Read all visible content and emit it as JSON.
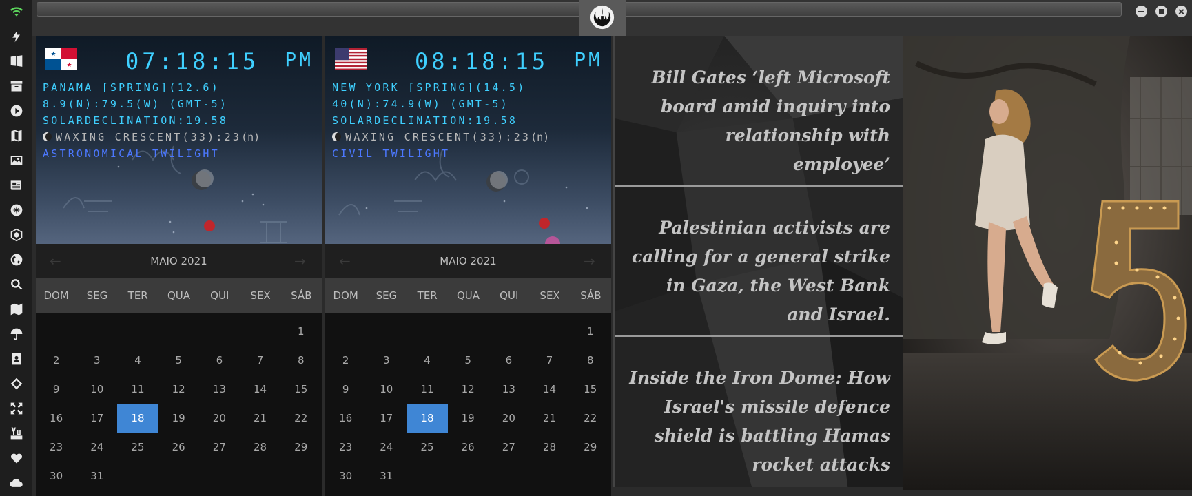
{
  "window": {
    "title_field": ""
  },
  "sidebar": {
    "items": [
      "wifi-icon",
      "lightning-icon",
      "windows-icon",
      "archive-icon",
      "play-icon",
      "map-book-icon",
      "image-icon",
      "news-icon",
      "rebel-icon",
      "hexagon-icon",
      "globe-icon",
      "search-icon",
      "map-icon",
      "umbrella-icon",
      "contact-icon",
      "link-icon",
      "expand-icon",
      "youtube-icon",
      "heart-icon",
      "cloud-icon"
    ]
  },
  "clocks": [
    {
      "flag": "panama",
      "time": "07:18:15",
      "ampm": "PM",
      "location": "PANAMA [SPRING](12.6)",
      "coords": "8.9(N):79.5(W) (GMT-5)",
      "solar": "SOLARDECLINATION:19.58",
      "moon": "WAXING CRESCENT(33):23",
      "moon_suffix": "(n)",
      "twilight": "ASTRONOMICAL TWILIGHT"
    },
    {
      "flag": "usa",
      "time": "08:18:15",
      "ampm": "PM",
      "location": "NEW YORK [SPRING](14.5)",
      "coords": "40(N):74.9(W) (GMT-5)",
      "solar": "SOLARDECLINATION:19.58",
      "moon": "WAXING CRESCENT(33):23",
      "moon_suffix": "(n)",
      "twilight": "CIVIL TWILIGHT"
    }
  ],
  "calendars": [
    {
      "month": "MAIO 2021",
      "prev": "←",
      "next": "→",
      "weekdays": [
        "DOM",
        "SEG",
        "TER",
        "QUA",
        "QUI",
        "SEX",
        "SÁB"
      ],
      "first_weekday": 6,
      "days_in_month": 31,
      "selected": 18
    },
    {
      "month": "MAIO 2021",
      "prev": "←",
      "next": "→",
      "weekdays": [
        "DOM",
        "SEG",
        "TER",
        "QUA",
        "QUI",
        "SEX",
        "SÁB"
      ],
      "first_weekday": 6,
      "days_in_month": 31,
      "selected": 18
    }
  ],
  "news": {
    "stories": [
      "Bill Gates ‘left Microsoft board amid inquiry into relationship with employee’",
      "Palestinian activists are calling for a general strike in Gaza, the West Bank and Israel.",
      "Inside the Iron Dome: How Israel's missile defence shield is battling Hamas rocket attacks"
    ]
  },
  "colors": {
    "clock_text": "#3fd0ff",
    "twilight_text": "#4c78ff",
    "selected_day": "#3f86d5"
  }
}
